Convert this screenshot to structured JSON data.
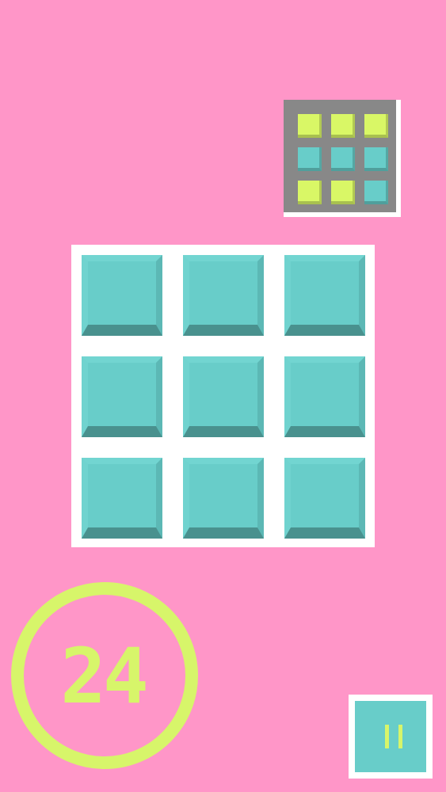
{
  "colors": {
    "background": "#ff96c8",
    "board": "#ffffff",
    "tile_teal": "#68cdc9",
    "tile_teal_dark": "#49918e",
    "tile_teal_light": "#79dbd7",
    "tile_lime": "#d9f766",
    "target_frame": "#888888",
    "accent_lime": "#d7f56a",
    "pause_fill": "#68cdc9"
  },
  "target_pattern": [
    [
      "lime",
      "lime",
      "lime"
    ],
    [
      "teal",
      "teal",
      "teal"
    ],
    [
      "lime",
      "lime",
      "teal"
    ]
  ],
  "board_tiles": [
    [
      "teal",
      "teal",
      "teal"
    ],
    [
      "teal",
      "teal",
      "teal"
    ],
    [
      "teal",
      "teal",
      "teal"
    ]
  ],
  "score": {
    "value": "24"
  },
  "pause_button": {
    "icon": "pause-icon"
  }
}
